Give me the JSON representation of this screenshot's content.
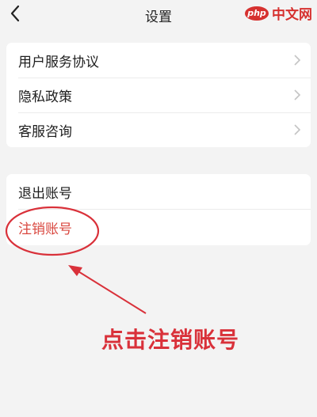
{
  "header": {
    "title": "设置",
    "back_icon": "chevron-left-icon"
  },
  "watermark": {
    "logo_text": "php",
    "site_text": "中文网",
    "color": "#d6312f"
  },
  "group1": {
    "items": [
      {
        "label": "用户服务协议"
      },
      {
        "label": "隐私政策"
      },
      {
        "label": "客服咨询"
      }
    ]
  },
  "group2": {
    "items": [
      {
        "label": "退出账号"
      },
      {
        "label": "注销账号"
      }
    ]
  },
  "annotation": {
    "text": "点击注销账号",
    "color": "#d9313a"
  }
}
